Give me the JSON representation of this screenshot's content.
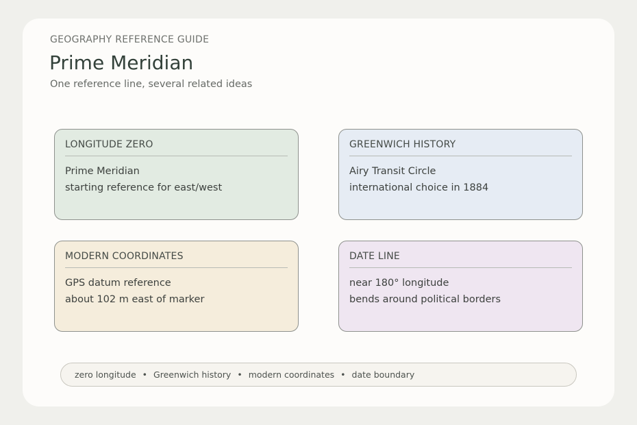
{
  "header": {
    "eyebrow": "GEOGRAPHY REFERENCE GUIDE",
    "title": "Prime Meridian",
    "subtitle": "One reference line, several related ideas"
  },
  "cards": [
    {
      "heading": "LONGITUDE ZERO",
      "line1": "Prime Meridian",
      "line2": "starting reference for east/west",
      "fill": "#e2ebe2"
    },
    {
      "heading": "GREENWICH HISTORY",
      "line1": "Airy Transit Circle",
      "line2": "international choice in 1884",
      "fill": "#e6ecf4"
    },
    {
      "heading": "MODERN COORDINATES",
      "line1": "GPS datum reference",
      "line2": "about 102 m east of marker",
      "fill": "#f5eddc"
    },
    {
      "heading": "DATE LINE",
      "line1": "near 180° longitude",
      "line2": "bends around political borders",
      "fill": "#efe6f1"
    }
  ],
  "footer": {
    "items": [
      "zero longitude",
      "Greenwich history",
      "modern coordinates",
      "date boundary"
    ],
    "separator": "•"
  }
}
